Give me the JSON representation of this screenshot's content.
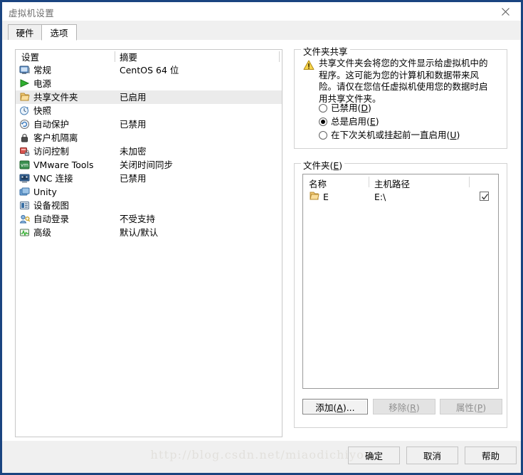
{
  "window": {
    "title": "虚拟机设置",
    "close_label": "✕"
  },
  "tabs": [
    {
      "label": "硬件",
      "active": false
    },
    {
      "label": "选项",
      "active": true
    }
  ],
  "settings_list": {
    "columns": [
      "设置",
      "摘要"
    ],
    "rows": [
      {
        "icon": "monitor-icon",
        "label": "常规",
        "summary": "CentOS 64 位",
        "selected": false
      },
      {
        "icon": "power-play-icon",
        "label": "电源",
        "summary": "",
        "selected": false
      },
      {
        "icon": "folder-icon",
        "label": "共享文件夹",
        "summary": "已启用",
        "selected": true
      },
      {
        "icon": "snapshot-clock-icon",
        "label": "快照",
        "summary": "",
        "selected": false
      },
      {
        "icon": "autoprotect-icon",
        "label": "自动保护",
        "summary": "已禁用",
        "selected": false
      },
      {
        "icon": "lock-icon",
        "label": "客户机隔离",
        "summary": "",
        "selected": false
      },
      {
        "icon": "access-control-icon",
        "label": "访问控制",
        "summary": "未加密",
        "selected": false
      },
      {
        "icon": "vmware-tools-icon",
        "label": "VMware Tools",
        "summary": "关闭时间同步",
        "selected": false
      },
      {
        "icon": "vnc-monitor-icon",
        "label": "VNC 连接",
        "summary": "已禁用",
        "selected": false
      },
      {
        "icon": "unity-icon",
        "label": "Unity",
        "summary": "",
        "selected": false
      },
      {
        "icon": "device-view-icon",
        "label": "设备视图",
        "summary": "",
        "selected": false
      },
      {
        "icon": "auto-login-icon",
        "label": "自动登录",
        "summary": "不受支持",
        "selected": false
      },
      {
        "icon": "advanced-icon",
        "label": "高级",
        "summary": "默认/默认",
        "selected": false
      }
    ]
  },
  "folder_sharing": {
    "group_title": "文件夹共享",
    "warning_icon": "warning-triangle-icon",
    "warning_text": "共享文件夹会将您的文件显示给虚拟机中的程序。这可能为您的计算机和数据带来风险。请仅在您信任虚拟机使用您的数据时启用共享文件夹。",
    "options": [
      {
        "label": "已禁用(D)",
        "accel": "D",
        "selected": false
      },
      {
        "label": "总是启用(E)",
        "accel": "E",
        "selected": true
      },
      {
        "label": "在下次关机或挂起前一直启用(U)",
        "accel": "U",
        "selected": false
      }
    ]
  },
  "folders": {
    "group_title": "文件夹(E)",
    "group_title_accel": "E",
    "columns": [
      "名称",
      "主机路径"
    ],
    "rows": [
      {
        "icon": "folder-icon",
        "name": "E",
        "host_path": "E:\\",
        "enabled": true
      }
    ],
    "buttons": [
      {
        "label": "添加(A)...",
        "accel": "A",
        "enabled": true
      },
      {
        "label": "移除(R)",
        "accel": "R",
        "enabled": false
      },
      {
        "label": "属性(P)",
        "accel": "P",
        "enabled": false
      }
    ]
  },
  "footer": {
    "watermark": "http://blog.csdn.net/miaodichiyou",
    "buttons": [
      {
        "label": "确定"
      },
      {
        "label": "取消"
      },
      {
        "label": "帮助"
      }
    ]
  },
  "colors": {
    "window_border": "#1a4480",
    "selection": "#ebebeb",
    "footer_bg": "#f0f0f0",
    "accel_underline": "#0000ff"
  }
}
